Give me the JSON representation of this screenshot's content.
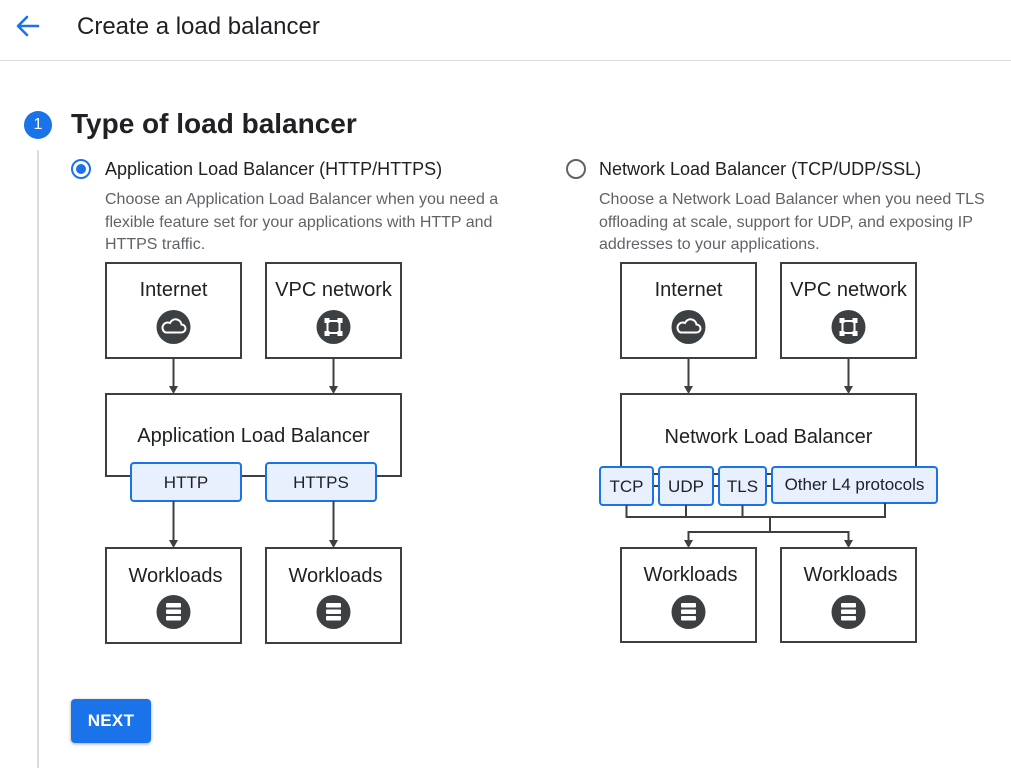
{
  "header": {
    "title": "Create a load balancer",
    "back_icon": "arrow-back-icon",
    "accent_color": "#1a73e8"
  },
  "step": {
    "number": "1",
    "title": "Type of load balancer"
  },
  "options": [
    {
      "label": "Application Load Balancer (HTTP/HTTPS)",
      "selected": true,
      "description": "Choose an Application Load Balancer when you need a flexible feature set for your applications with HTTP and HTTPS traffic.",
      "diagram": {
        "sources": [
          "Internet",
          "VPC network"
        ],
        "balancer": "Application Load Balancer",
        "protocols": [
          "HTTP",
          "HTTPS"
        ],
        "targets": [
          "Workloads",
          "Workloads"
        ]
      }
    },
    {
      "label": "Network Load Balancer (TCP/UDP/SSL)",
      "selected": false,
      "description": "Choose a Network Load Balancer when you need TLS offloading at scale, support for UDP, and exposing IP addresses to your applications.",
      "diagram": {
        "sources": [
          "Internet",
          "VPC network"
        ],
        "balancer": "Network Load Balancer",
        "protocols": [
          "TCP",
          "UDP",
          "TLS",
          "Other L4 protocols"
        ],
        "targets": [
          "Workloads",
          "Workloads"
        ]
      }
    }
  ],
  "icons": {
    "internet": "cloud-icon",
    "vpc": "network-icon",
    "workloads": "database-icon"
  },
  "actions": {
    "next_label": "NEXT"
  }
}
